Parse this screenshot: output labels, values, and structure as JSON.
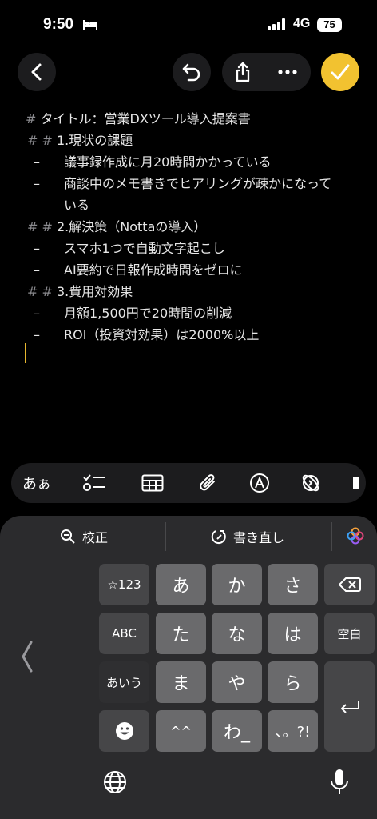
{
  "status_bar": {
    "time": "9:50",
    "network": "4G",
    "battery": "75"
  },
  "note": {
    "lines": [
      {
        "mark": "#",
        "text": " タイトル：営業DXツール導入提案書"
      },
      {
        "mark": "# #",
        "text": " 1.現状の課題"
      },
      {
        "mark": "–",
        "text": "議事録作成に月20時間かかっている"
      },
      {
        "mark": "–",
        "text": "商談中のメモ書きでヒアリングが疎かになって"
      },
      {
        "mark": "",
        "text": "いる"
      },
      {
        "mark": "# #",
        "text": " 2.解決策（Nottaの導入）"
      },
      {
        "mark": "–",
        "text": "スマホ1つで自動文字起こし"
      },
      {
        "mark": "–",
        "text": "AI要約で日報作成時間をゼロに"
      },
      {
        "mark": "# #",
        "text": " 3.費用対効果"
      },
      {
        "mark": "–",
        "text": "月額1,500円で20時間の削減"
      },
      {
        "mark": "–",
        "text": "ROI（投資対効果）は2000%以上"
      }
    ]
  },
  "toolbar": {
    "kana_label": "あぁ"
  },
  "keyboard": {
    "suggestions": {
      "proofread": "校正",
      "rewrite": "書き直し"
    },
    "keys": {
      "num": "☆123",
      "a": "あ",
      "ka": "か",
      "sa": "さ",
      "abc": "ABC",
      "ta": "た",
      "na": "な",
      "ha": "は",
      "space": "空白",
      "aiu": "あいう",
      "ma": "ま",
      "ya": "や",
      "ra": "ら",
      "hat": "^^",
      "wa": "わ_",
      "punct": "、。?!"
    }
  },
  "colors": {
    "accent": "#f2c230",
    "cursor": "#e5b52e"
  }
}
